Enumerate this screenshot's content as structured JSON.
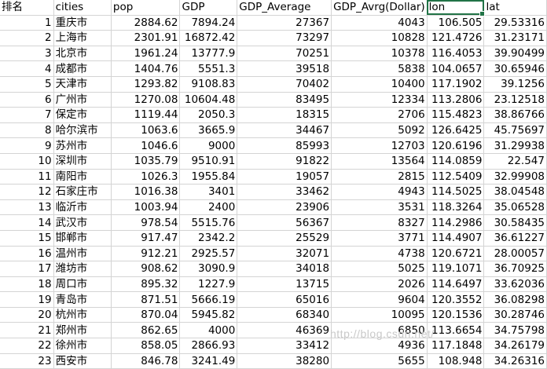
{
  "headers": [
    "排名",
    "cities",
    "pop",
    "GDP",
    "GDP_Average",
    "GDP_Avrg(Dollar)",
    "lon",
    "lat"
  ],
  "rows": [
    [
      "1",
      "重庆市",
      "2884.62",
      "7894.24",
      "27367",
      "4043",
      "106.505",
      "29.53316"
    ],
    [
      "2",
      "上海市",
      "2301.91",
      "16872.42",
      "73297",
      "10828",
      "121.4726",
      "31.23171"
    ],
    [
      "3",
      "北京市",
      "1961.24",
      "13777.9",
      "70251",
      "10378",
      "116.4053",
      "39.90499"
    ],
    [
      "4",
      "成都市",
      "1404.76",
      "5551.3",
      "39518",
      "5838",
      "104.0657",
      "30.65946"
    ],
    [
      "5",
      "天津市",
      "1293.82",
      "9108.83",
      "70402",
      "10400",
      "117.1902",
      "39.1256"
    ],
    [
      "6",
      "广州市",
      "1270.08",
      "10604.48",
      "83495",
      "12334",
      "113.2806",
      "23.12518"
    ],
    [
      "7",
      "保定市",
      "1119.44",
      "2050.3",
      "18315",
      "2706",
      "115.4823",
      "38.86766"
    ],
    [
      "8",
      "哈尔滨市",
      "1063.6",
      "3665.9",
      "34467",
      "5092",
      "126.6425",
      "45.75697"
    ],
    [
      "9",
      "苏州市",
      "1046.6",
      "9000",
      "85993",
      "12703",
      "120.6196",
      "31.29938"
    ],
    [
      "10",
      "深圳市",
      "1035.79",
      "9510.91",
      "91822",
      "13564",
      "114.0859",
      "22.547"
    ],
    [
      "11",
      "南阳市",
      "1026.3",
      "1955.84",
      "19057",
      "2815",
      "112.5409",
      "32.99908"
    ],
    [
      "12",
      "石家庄市",
      "1016.38",
      "3401",
      "33462",
      "4943",
      "114.5025",
      "38.04548"
    ],
    [
      "13",
      "临沂市",
      "1003.94",
      "2400",
      "23906",
      "3531",
      "118.3264",
      "35.06528"
    ],
    [
      "14",
      "武汉市",
      "978.54",
      "5515.76",
      "56367",
      "8327",
      "114.2986",
      "30.58435"
    ],
    [
      "15",
      "邯郸市",
      "917.47",
      "2342.2",
      "25529",
      "3771",
      "114.4907",
      "36.61227"
    ],
    [
      "16",
      "温州市",
      "912.21",
      "2925.57",
      "32071",
      "4738",
      "120.6721",
      "28.00057"
    ],
    [
      "17",
      "潍坊市",
      "908.62",
      "3090.9",
      "34018",
      "5025",
      "119.1071",
      "36.70925"
    ],
    [
      "18",
      "周口市",
      "895.32",
      "1227.9",
      "13715",
      "2026",
      "114.6497",
      "33.62036"
    ],
    [
      "19",
      "青岛市",
      "871.51",
      "5666.19",
      "65016",
      "9604",
      "120.3552",
      "36.08298"
    ],
    [
      "20",
      "杭州市",
      "870.04",
      "5945.82",
      "68340",
      "10095",
      "120.1536",
      "30.28746"
    ],
    [
      "21",
      "郑州市",
      "862.65",
      "4000",
      "46369",
      "6850",
      "113.6654",
      "34.75798"
    ],
    [
      "22",
      "徐州市",
      "858.05",
      "2866.93",
      "33412",
      "4936",
      "117.1848",
      "34.26179"
    ],
    [
      "23",
      "西安市",
      "846.78",
      "3241.49",
      "38280",
      "5655",
      "108.948",
      "34.26316"
    ]
  ],
  "watermark": "http://blog.csdn.net/"
}
